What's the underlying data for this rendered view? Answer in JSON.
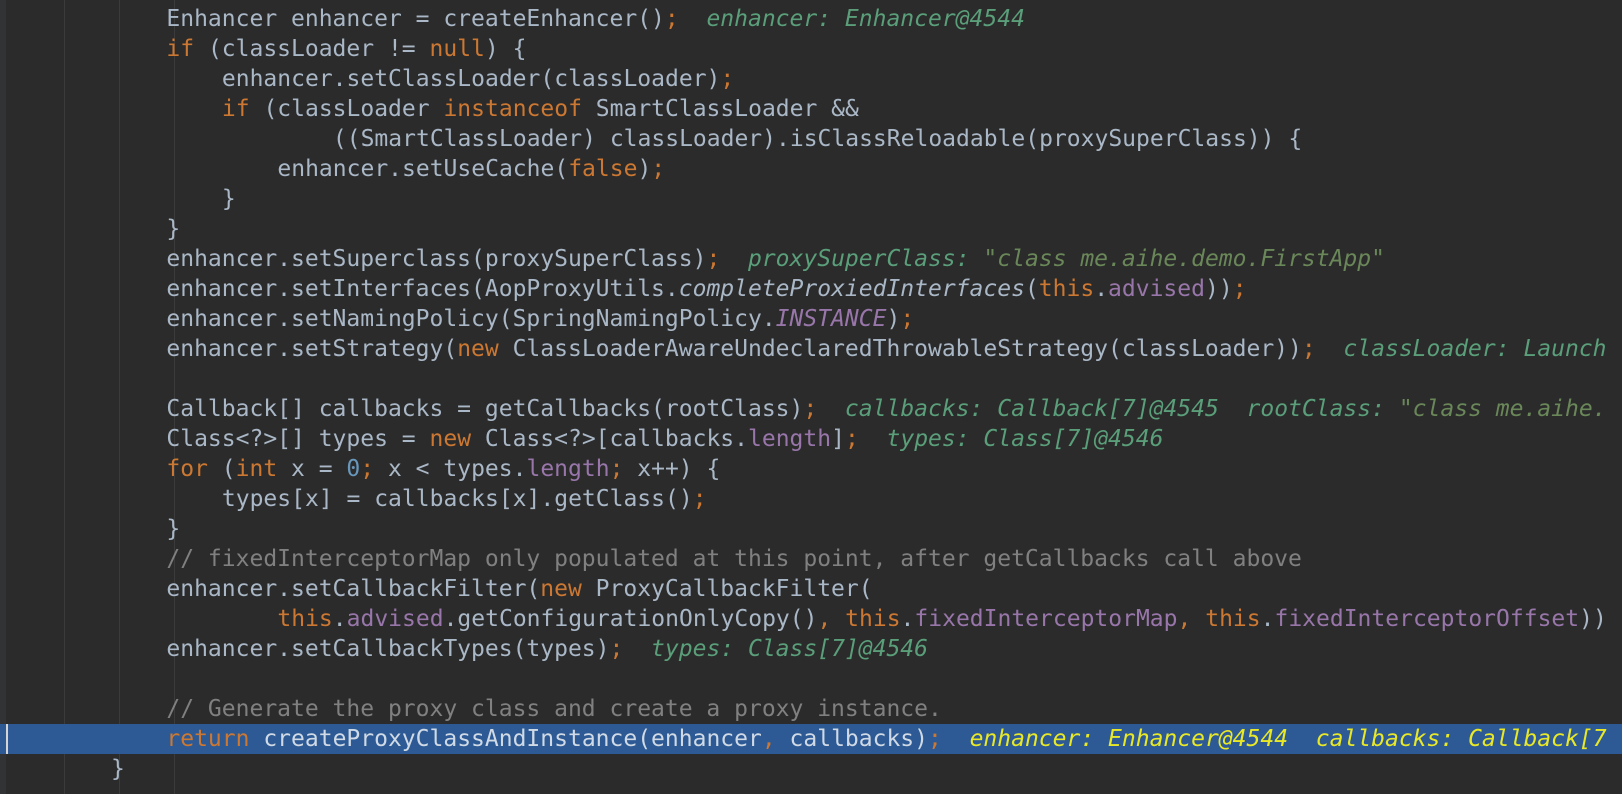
{
  "colors": {
    "background": "#2b2b2b",
    "keyword": "#cc7832",
    "plain": "#a9b7c6",
    "field": "#9876aa",
    "number": "#6897bb",
    "comment": "#808080",
    "debug_hint": "#5a9e7a",
    "selection": "#2d5a94",
    "selection_hint": "#e8e828"
  },
  "lines": [
    {
      "indent": 3,
      "tokens": [
        {
          "t": "Enhancer enhancer = createEnhancer()",
          "c": "p"
        },
        {
          "t": ";",
          "c": "k"
        },
        {
          "t": "  enhancer: Enhancer@4544",
          "c": "hint"
        }
      ]
    },
    {
      "indent": 3,
      "tokens": [
        {
          "t": "if ",
          "c": "k"
        },
        {
          "t": "(classLoader != ",
          "c": "p"
        },
        {
          "t": "null",
          "c": "k"
        },
        {
          "t": ") {",
          "c": "p"
        }
      ]
    },
    {
      "indent": 4,
      "tokens": [
        {
          "t": "enhancer.setClassLoader(classLoader)",
          "c": "p"
        },
        {
          "t": ";",
          "c": "k"
        }
      ]
    },
    {
      "indent": 4,
      "tokens": [
        {
          "t": "if ",
          "c": "k"
        },
        {
          "t": "(classLoader ",
          "c": "p"
        },
        {
          "t": "instanceof ",
          "c": "k"
        },
        {
          "t": "SmartClassLoader &&",
          "c": "p"
        }
      ]
    },
    {
      "indent": 6,
      "tokens": [
        {
          "t": "((SmartClassLoader) classLoader).isClassReloadable(proxySuperClass)) {",
          "c": "p"
        }
      ]
    },
    {
      "indent": 5,
      "tokens": [
        {
          "t": "enhancer.setUseCache(",
          "c": "p"
        },
        {
          "t": "false",
          "c": "k"
        },
        {
          "t": ")",
          "c": "p"
        },
        {
          "t": ";",
          "c": "k"
        }
      ]
    },
    {
      "indent": 4,
      "tokens": [
        {
          "t": "}",
          "c": "p"
        }
      ]
    },
    {
      "indent": 3,
      "tokens": [
        {
          "t": "}",
          "c": "p"
        }
      ]
    },
    {
      "indent": 3,
      "tokens": [
        {
          "t": "enhancer.setSuperclass(proxySuperClass)",
          "c": "p"
        },
        {
          "t": ";",
          "c": "k"
        },
        {
          "t": "  proxySuperClass: ",
          "c": "hint"
        },
        {
          "t": "\"class me.aihe.demo.FirstApp\"",
          "c": "hintstr"
        }
      ]
    },
    {
      "indent": 3,
      "tokens": [
        {
          "t": "enhancer.setInterfaces(AopProxyUtils.",
          "c": "p"
        },
        {
          "t": "completeProxiedInterfaces",
          "c": "it"
        },
        {
          "t": "(",
          "c": "p"
        },
        {
          "t": "this",
          "c": "k"
        },
        {
          "t": ".",
          "c": "p"
        },
        {
          "t": "advised",
          "c": "m"
        },
        {
          "t": "))",
          "c": "p"
        },
        {
          "t": ";",
          "c": "k"
        }
      ]
    },
    {
      "indent": 3,
      "tokens": [
        {
          "t": "enhancer.setNamingPolicy(SpringNamingPolicy.",
          "c": "p"
        },
        {
          "t": "INSTANCE",
          "c": "mi"
        },
        {
          "t": ")",
          "c": "p"
        },
        {
          "t": ";",
          "c": "k"
        }
      ]
    },
    {
      "indent": 3,
      "tokens": [
        {
          "t": "enhancer.setStrategy(",
          "c": "p"
        },
        {
          "t": "new ",
          "c": "k"
        },
        {
          "t": "ClassLoaderAwareUndeclaredThrowableStrategy(classLoader))",
          "c": "p"
        },
        {
          "t": ";",
          "c": "k"
        },
        {
          "t": "  classLoader: Launch",
          "c": "hint"
        }
      ]
    },
    {
      "indent": 0,
      "tokens": []
    },
    {
      "indent": 3,
      "tokens": [
        {
          "t": "Callback[] callbacks = getCallbacks(rootClass)",
          "c": "p"
        },
        {
          "t": ";",
          "c": "k"
        },
        {
          "t": "  callbacks: Callback[7]@4545  rootClass: ",
          "c": "hint"
        },
        {
          "t": "\"class me.aihe.",
          "c": "hintstr"
        }
      ]
    },
    {
      "indent": 3,
      "tokens": [
        {
          "t": "Class<?>[] types = ",
          "c": "p"
        },
        {
          "t": "new ",
          "c": "k"
        },
        {
          "t": "Class<?>[callbacks.",
          "c": "p"
        },
        {
          "t": "length",
          "c": "m"
        },
        {
          "t": "]",
          "c": "p"
        },
        {
          "t": ";",
          "c": "k"
        },
        {
          "t": "  types: Class[7]@4546",
          "c": "hint"
        }
      ]
    },
    {
      "indent": 3,
      "tokens": [
        {
          "t": "for ",
          "c": "k"
        },
        {
          "t": "(",
          "c": "p"
        },
        {
          "t": "int ",
          "c": "k"
        },
        {
          "t": "x = ",
          "c": "p"
        },
        {
          "t": "0",
          "c": "n"
        },
        {
          "t": "; ",
          "c": "k"
        },
        {
          "t": "x < types.",
          "c": "p"
        },
        {
          "t": "length",
          "c": "m"
        },
        {
          "t": "; ",
          "c": "k"
        },
        {
          "t": "x++) {",
          "c": "p"
        }
      ]
    },
    {
      "indent": 4,
      "tokens": [
        {
          "t": "types[x] = callbacks[x].getClass()",
          "c": "p"
        },
        {
          "t": ";",
          "c": "k"
        }
      ]
    },
    {
      "indent": 3,
      "tokens": [
        {
          "t": "}",
          "c": "p"
        }
      ]
    },
    {
      "indent": 3,
      "tokens": [
        {
          "t": "// fixedInterceptorMap only populated at this point, after getCallbacks call above",
          "c": "c"
        }
      ]
    },
    {
      "indent": 3,
      "tokens": [
        {
          "t": "enhancer.setCallbackFilter(",
          "c": "p"
        },
        {
          "t": "new ",
          "c": "k"
        },
        {
          "t": "ProxyCallbackFilter(",
          "c": "p"
        }
      ]
    },
    {
      "indent": 5,
      "tokens": [
        {
          "t": "this",
          "c": "k"
        },
        {
          "t": ".",
          "c": "p"
        },
        {
          "t": "advised",
          "c": "m"
        },
        {
          "t": ".getConfigurationOnlyCopy()",
          "c": "p"
        },
        {
          "t": ", ",
          "c": "k"
        },
        {
          "t": "this",
          "c": "k"
        },
        {
          "t": ".",
          "c": "p"
        },
        {
          "t": "fixedInterceptorMap",
          "c": "m"
        },
        {
          "t": ", ",
          "c": "k"
        },
        {
          "t": "this",
          "c": "k"
        },
        {
          "t": ".",
          "c": "p"
        },
        {
          "t": "fixedInterceptorOffset",
          "c": "m"
        },
        {
          "t": "))",
          "c": "p"
        }
      ]
    },
    {
      "indent": 3,
      "tokens": [
        {
          "t": "enhancer.setCallbackTypes(types)",
          "c": "p"
        },
        {
          "t": ";",
          "c": "k"
        },
        {
          "t": "  types: Class[7]@4546",
          "c": "hint"
        }
      ]
    },
    {
      "indent": 0,
      "tokens": []
    },
    {
      "indent": 3,
      "tokens": [
        {
          "t": "// Generate the proxy class and create a proxy instance.",
          "c": "c"
        }
      ]
    },
    {
      "indent": 3,
      "highlight": true,
      "tokens": [
        {
          "t": "return ",
          "c": "k"
        },
        {
          "t": "createProxyClassAndInstance(enhancer",
          "c": "p"
        },
        {
          "t": ", ",
          "c": "k"
        },
        {
          "t": "callbacks)",
          "c": "p"
        },
        {
          "t": ";",
          "c": "k"
        },
        {
          "t": "  enhancer: Enhancer@4544  callbacks: Callback[7",
          "c": "hint"
        }
      ]
    },
    {
      "indent": 2,
      "tokens": [
        {
          "t": "}",
          "c": "p"
        }
      ]
    }
  ]
}
